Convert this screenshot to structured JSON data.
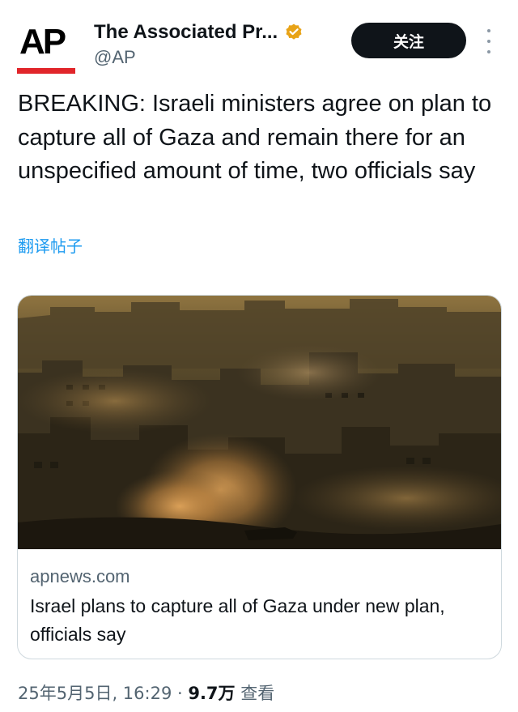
{
  "header": {
    "display_name": "The Associated Pr...",
    "handle": "@AP",
    "avatar_text": "AP",
    "follow_label": "关注",
    "verified_icon": "verified-badge-icon",
    "verified_color": "#e8a317",
    "more_icon": "vertical-ellipsis-icon"
  },
  "tweet": {
    "text": "BREAKING: Israeli ministers agree on plan to capture all of Gaza and remain there for an unspecified amount of time, two officials say",
    "translate_label": "翻译帖子"
  },
  "card": {
    "domain": "apnews.com",
    "title": "Israel plans to capture all of Gaza under new plan, officials say"
  },
  "meta": {
    "timestamp": "25年5月5日, 16:29",
    "separator": " · ",
    "views_count": "9.7万",
    "views_label": " 查看"
  },
  "colors": {
    "accent": "#1d9bf0",
    "ap_red": "#e1252a",
    "text_primary": "#0f1419",
    "text_secondary": "#536471"
  }
}
